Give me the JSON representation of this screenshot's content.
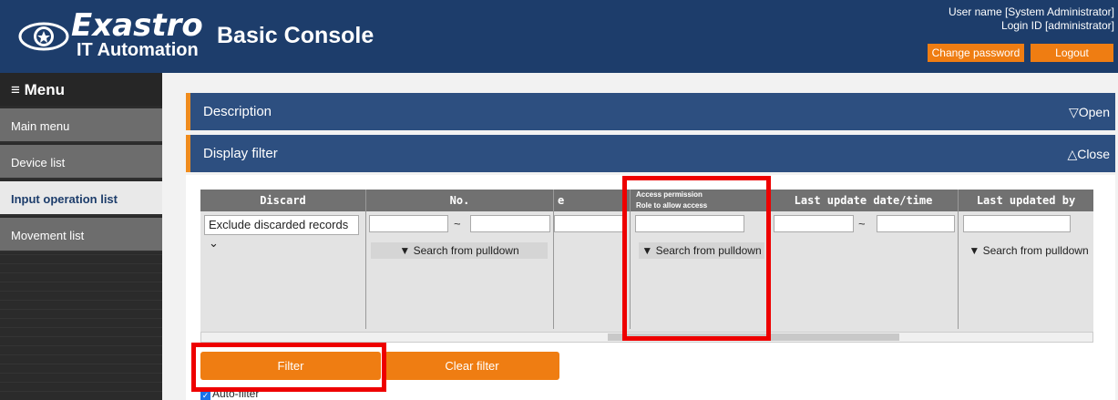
{
  "header": {
    "logo_title": "Exastro",
    "logo_sub": "IT Automation",
    "app_title": "Basic Console",
    "user_name": "User name [System Administrator]",
    "login_id": "Login ID [administrator]",
    "change_password": "Change password",
    "logout": "Logout"
  },
  "sidebar": {
    "menu_title": "≡ Menu",
    "items": [
      {
        "label": "Main menu"
      },
      {
        "label": "Device list"
      },
      {
        "label": "Input operation list"
      },
      {
        "label": "Movement list"
      }
    ],
    "active_item": "Input operation list"
  },
  "sections": {
    "description": {
      "label": "Description",
      "toggle": "▽Open"
    },
    "display_filter": {
      "label": "Display filter",
      "toggle": "△Close"
    }
  },
  "filter_table": {
    "columns": {
      "discard": "Discard",
      "no": "No.",
      "partial": "e",
      "access_line1": "Access permission",
      "access_line2": "Role to allow access",
      "last_update": "Last update date/time",
      "last_updated_by": "Last updated by"
    },
    "discard_value": "Exclude discarded records ⌄",
    "tilde": "~",
    "pulldown": "▼ Search from pulldown"
  },
  "actions": {
    "filter": "Filter",
    "clear_filter": "Clear filter",
    "auto_filter": "Auto-filter",
    "auto_filter_checked": true
  },
  "colors": {
    "header_bg": "#1d3d6b",
    "accent": "#ef7d12",
    "highlight": "#ee0000"
  }
}
